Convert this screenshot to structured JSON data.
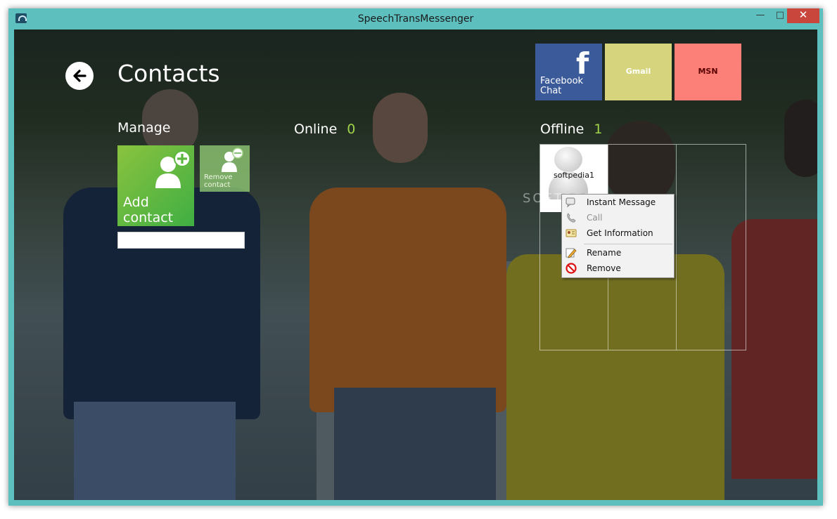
{
  "window": {
    "title": "SpeechTransMessenger",
    "min_glyph": "—",
    "max_glyph": "□",
    "close_glyph": "✕"
  },
  "page": {
    "title": "Contacts"
  },
  "manage": {
    "label": "Manage",
    "add_line1": "Add",
    "add_line2": "contact",
    "remove_line1": "Remove",
    "remove_line2": "contact",
    "input_value": ""
  },
  "online": {
    "label": "Online",
    "count": "0"
  },
  "offline": {
    "label": "Offline",
    "count": "1"
  },
  "networks": {
    "facebook_line1": "Facebook",
    "facebook_line2": "Chat",
    "facebook_glyph": "f",
    "gmail": "Gmail",
    "msn": "MSN"
  },
  "contacts": [
    {
      "name": "softpedia1"
    }
  ],
  "watermark": "SOFTPEDIA",
  "context_menu": {
    "items": [
      {
        "label": "Instant Message",
        "icon": "chat-icon",
        "enabled": true
      },
      {
        "label": "Call",
        "icon": "phone-icon",
        "enabled": false
      },
      {
        "label": "Get Information",
        "icon": "info-card-icon",
        "enabled": true
      },
      {
        "label": "Rename",
        "icon": "pencil-icon",
        "enabled": true
      },
      {
        "label": "Remove",
        "icon": "no-entry-icon",
        "enabled": true
      }
    ]
  },
  "colors": {
    "titlebar": "#5ebfbf",
    "add_tile": "#5cb73f",
    "online_count": "#9fd34a",
    "facebook": "#3b5a9a",
    "gmail": "#d6d57d",
    "msn": "#fc8078",
    "close_button": "#c9463d"
  }
}
